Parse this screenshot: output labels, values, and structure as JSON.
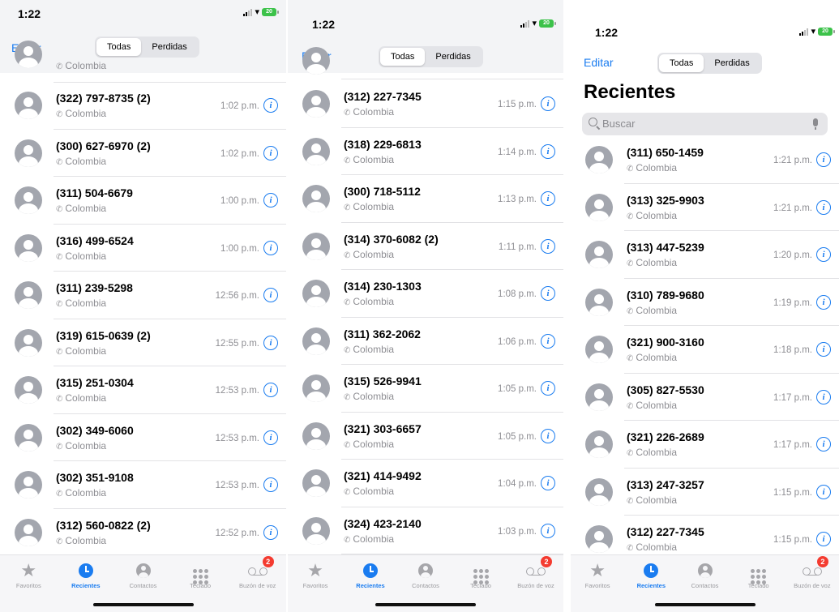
{
  "statusbar": {
    "time": "1:22",
    "battery": "20"
  },
  "header": {
    "edit_label": "Editar",
    "segments": [
      "Todas",
      "Perdidas"
    ]
  },
  "title": "Recientes",
  "search": {
    "placeholder": "Buscar"
  },
  "tabbar": [
    {
      "label": "Favoritos",
      "icon": "star-icon"
    },
    {
      "label": "Recientes",
      "icon": "clock-icon",
      "active": true
    },
    {
      "label": "Contactos",
      "icon": "person-icon"
    },
    {
      "label": "Teclado",
      "icon": "keypad-icon"
    },
    {
      "label": "Buzón de voz",
      "icon": "voicemail-icon",
      "badge": "2"
    }
  ],
  "colors": {
    "accent": "#1a7cf0",
    "badge": "#f43b30",
    "battery": "#3cc24a"
  },
  "screens": [
    {
      "peek_label": "Colombia",
      "rows": [
        {
          "number": "(322) 797-8735 (2)",
          "label": "Colombia",
          "time": "1:02 p.m."
        },
        {
          "number": "(300) 627-6970 (2)",
          "label": "Colombia",
          "time": "1:02 p.m."
        },
        {
          "number": "(311) 504-6679",
          "label": "Colombia",
          "time": "1:00 p.m."
        },
        {
          "number": "(316) 499-6524",
          "label": "Colombia",
          "time": "1:00 p.m."
        },
        {
          "number": "(311) 239-5298",
          "label": "Colombia",
          "time": "12:56 p.m."
        },
        {
          "number": "(319) 615-0639 (2)",
          "label": "Colombia",
          "time": "12:55 p.m."
        },
        {
          "number": "(315) 251-0304",
          "label": "Colombia",
          "time": "12:53 p.m."
        },
        {
          "number": "(302) 349-6060",
          "label": "Colombia",
          "time": "12:53 p.m."
        },
        {
          "number": "(302) 351-9108",
          "label": "Colombia",
          "time": "12:53 p.m."
        },
        {
          "number": "(312) 560-0822 (2)",
          "label": "Colombia",
          "time": "12:52 p.m."
        }
      ]
    },
    {
      "peek_label": "Colombia",
      "rows": [
        {
          "number": "(312) 227-7345",
          "label": "Colombia",
          "time": "1:15 p.m."
        },
        {
          "number": "(318) 229-6813",
          "label": "Colombia",
          "time": "1:14 p.m."
        },
        {
          "number": "(300) 718-5112",
          "label": "Colombia",
          "time": "1:13 p.m."
        },
        {
          "number": "(314) 370-6082 (2)",
          "label": "Colombia",
          "time": "1:11 p.m."
        },
        {
          "number": "(314) 230-1303",
          "label": "Colombia",
          "time": "1:08 p.m."
        },
        {
          "number": "(311) 362-2062",
          "label": "Colombia",
          "time": "1:06 p.m."
        },
        {
          "number": "(315) 526-9941",
          "label": "Colombia",
          "time": "1:05 p.m."
        },
        {
          "number": "(321) 303-6657",
          "label": "Colombia",
          "time": "1:05 p.m."
        },
        {
          "number": "(321) 414-9492",
          "label": "Colombia",
          "time": "1:04 p.m."
        },
        {
          "number": "(324) 423-2140",
          "label": "Colombia",
          "time": "1:03 p.m."
        }
      ]
    },
    {
      "rows": [
        {
          "number": "(311) 650-1459",
          "label": "Colombia",
          "time": "1:21 p.m."
        },
        {
          "number": "(313) 325-9903",
          "label": "Colombia",
          "time": "1:21 p.m."
        },
        {
          "number": "(313) 447-5239",
          "label": "Colombia",
          "time": "1:20 p.m."
        },
        {
          "number": "(310) 789-9680",
          "label": "Colombia",
          "time": "1:19 p.m."
        },
        {
          "number": "(321) 900-3160",
          "label": "Colombia",
          "time": "1:18 p.m."
        },
        {
          "number": "(305) 827-5530",
          "label": "Colombia",
          "time": "1:17 p.m."
        },
        {
          "number": "(321) 226-2689",
          "label": "Colombia",
          "time": "1:17 p.m."
        },
        {
          "number": "(313) 247-3257",
          "label": "Colombia",
          "time": "1:15 p.m."
        },
        {
          "number": "(312) 227-7345",
          "label": "Colombia",
          "time": "1:15 p.m."
        }
      ]
    }
  ]
}
